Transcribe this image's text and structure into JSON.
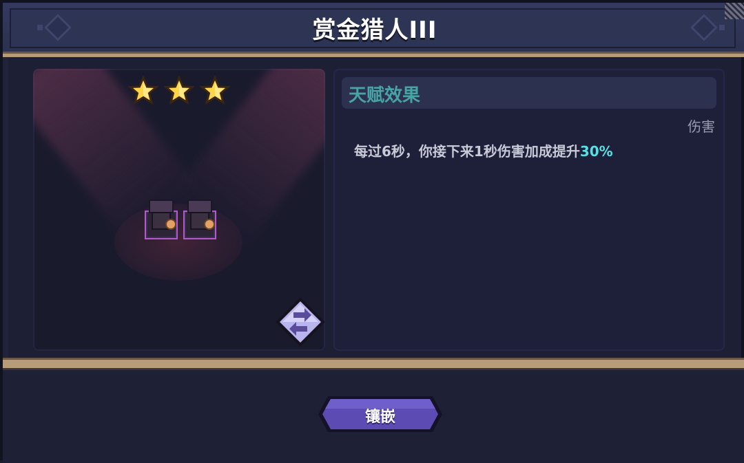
{
  "header": {
    "title": "赏金猎人III"
  },
  "left_panel": {
    "star_count": 3,
    "unit_count": 2
  },
  "talent": {
    "section_title": "天赋效果",
    "tag": "伤害",
    "description_prefix": "每过6秒，你接下来1秒伤害加成提升",
    "description_highlight": "30%"
  },
  "footer": {
    "embed_label": "镶嵌"
  },
  "colors": {
    "accent_teal": "#48a3a5",
    "highlight_cyan": "#56e0e4",
    "button_purple": "#5b4bb3",
    "rail_gold": "#b89c79"
  },
  "icons": [
    "star-icon",
    "swap-icon"
  ]
}
